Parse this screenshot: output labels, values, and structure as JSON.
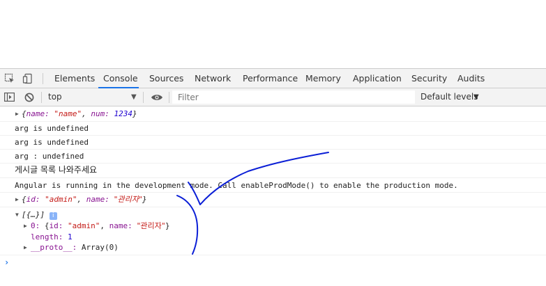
{
  "tabs": [
    "Elements",
    "Console",
    "Sources",
    "Network",
    "Performance",
    "Memory",
    "Application",
    "Security",
    "Audits"
  ],
  "active_tab": "Console",
  "toolbar": {
    "context": "top",
    "filter_placeholder": "Filter",
    "levels": "Default levels"
  },
  "console": {
    "log1": {
      "name_key": "name:",
      "name_val": "\"name\"",
      "num_key": "num:",
      "num_val": "1234"
    },
    "log2": "arg is undefined",
    "log3": "arg is undefined",
    "log4": "arg : undefined",
    "log5": "게시글 목록 나와주세요",
    "log6": "Angular is running in the development mode. Call enableProdMode() to enable the production mode.",
    "log7": {
      "id_key": "id:",
      "id_val": "\"admin\"",
      "name_key": "name:",
      "name_val": "\"관리자\""
    },
    "log8": {
      "summary": "[{…}]",
      "badge": "i",
      "item0_index": "0:",
      "item0": {
        "id_key": "id:",
        "id_val": "\"admin\"",
        "name_key": "name:",
        "name_val": "\"관리자\""
      },
      "length_key": "length:",
      "length_val": "1",
      "proto_key": "__proto__:",
      "proto_val": "Array(0)"
    }
  },
  "colors": {
    "accent": "#1a73e8",
    "string": "#c41a16",
    "number": "#1c00cf",
    "property": "#881391",
    "annotation": "#0b1fd6"
  }
}
